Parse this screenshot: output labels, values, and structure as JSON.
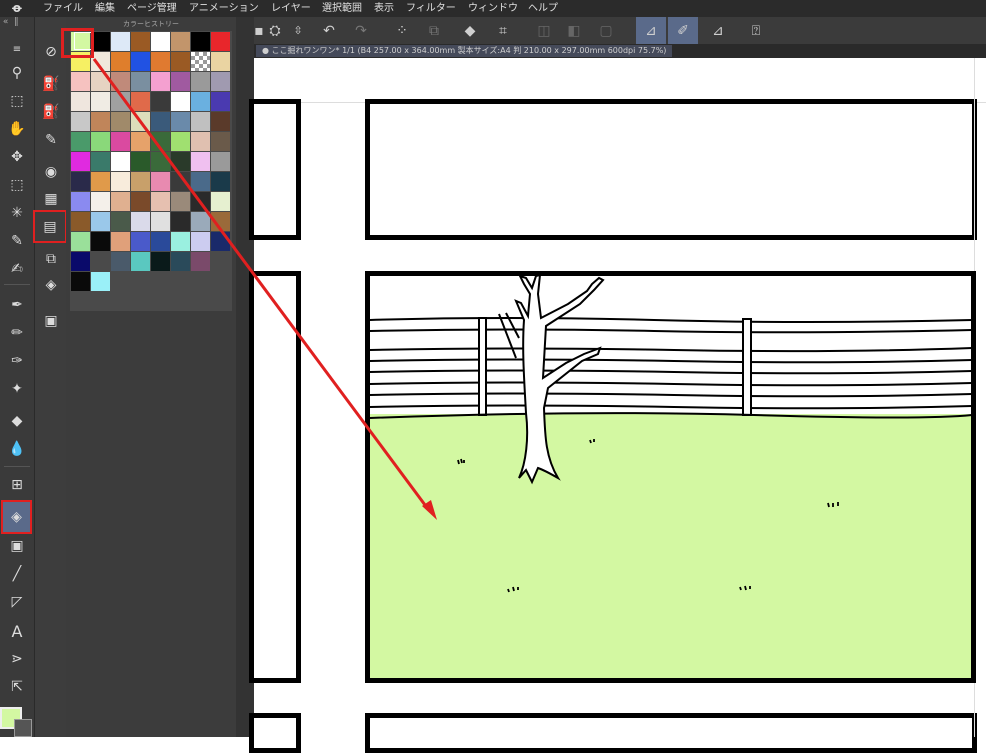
{
  "menubar": {
    "items": [
      "ファイル",
      "編集",
      "ページ管理",
      "アニメーション",
      "レイヤー",
      "選択範囲",
      "表示",
      "フィルター",
      "ウィンドウ",
      "ヘルプ"
    ]
  },
  "palette": {
    "title": "カラーヒストリー",
    "selected_color": "#d3f8a2",
    "swatches": [
      [
        "#d3f8a2",
        "#000000",
        "#dde9f7",
        "#9a5a24",
        "#ffffff",
        "#c2956b",
        "#000000",
        "#e8262b"
      ],
      [
        "#f6f063",
        "#f0e8dc",
        "#df7e2c",
        "#2152e3",
        "#e07a30",
        "#9a5a24",
        "checker",
        "#ead4a2"
      ],
      [
        "#f6c2c0",
        "#e6d3c2",
        "#c08a7a",
        "#7a8fa0",
        "#f4a0d0",
        "#a05aa0",
        "#9a9a9a",
        "#a09ab0"
      ],
      [
        "#efe6de",
        "#f0ece4",
        "#a0a0a0",
        "#e06a4a",
        "#3a3a3a",
        "#ffffff",
        "#6ab0e0",
        "#4a3ab0"
      ],
      [
        "#c8c8c8",
        "#c0855a",
        "#a08a6a",
        "#ddddbb",
        "#3a5a7a",
        "#6a8aaa",
        "#c0c0c0",
        "#5a3a2a"
      ],
      [
        "#4a9a6a",
        "#8ad87a",
        "#da4aa0",
        "#e6a26a",
        "#3a6a3a",
        "#a0e070",
        "#e0c0b0",
        "#6a5a4a"
      ],
      [
        "#e02ae0",
        "#3a7a6a",
        "#ffffff",
        "#2a5a2a",
        "#3a6a3a",
        "#2a3a2a",
        "#f0c0f0",
        "#9a9a9a"
      ],
      [
        "#2a2a4a",
        "#e09a4a",
        "#f8ecdc",
        "#c8a06a",
        "#e88ab0",
        "#3a3a3a",
        "#4a6a8a",
        "#1a3a4a"
      ],
      [
        "#8a8af0",
        "#f4f0ea",
        "#e0b090",
        "#7a4a2a",
        "#e6c0b0",
        "#9a8a7a",
        "#2a2a2a",
        "#e6f0d0"
      ],
      [
        "#8a5a2a",
        "#9ac8ea",
        "#4a5a4a",
        "#dadaea",
        "#e0e0e0",
        "#2a2a2a",
        "#9aaaba",
        "#9a6a3a"
      ],
      [
        "#9ae09a",
        "#0a0a0a",
        "#e0a07a",
        "#4a5aca",
        "#2a4a9a",
        "#9af0e0",
        "#ccccf0",
        "#1a2a6a"
      ],
      [
        "#0a0a6a",
        "#4a4a4a",
        "#4a5a6a",
        "#5ac8c0",
        "#0a1a1a",
        "#2a4a5a",
        "#7a4a6a",
        "#4a4a4a"
      ],
      [
        "#0a0a0a",
        "#9af0f8"
      ]
    ]
  },
  "document": {
    "tab_label": "ここ掘れワンワン* 1/1 (B4 257.00 x 364.00mm 製本サイズ:A4 判 210.00 x 297.00mm 600dpi 75.7%)"
  },
  "tools": {
    "main": [
      "menu-icon",
      "zoom-icon",
      "operation-icon",
      "hand-icon",
      "move-icon",
      "selection-icon",
      "magic-wand-icon",
      "eyedropper-icon",
      "pen-icon",
      "pencil-icon",
      "brush-icon",
      "airbrush-icon",
      "decoration-icon",
      "eraser-icon",
      "blend-icon",
      "frame-icon",
      "fill-icon",
      "gradient-icon",
      "line-icon",
      "ruler-icon",
      "text-icon",
      "balloon-icon",
      "correct-line-icon"
    ],
    "sub": [
      "refer-layer-icon",
      "fill-layer-icon",
      "fill-close-icon",
      "fill-paint-icon",
      "fill-circle-icon",
      "fill-grid-icon",
      "fill-selected-icon",
      "stack-icon",
      "layers-icon",
      "canvas-icon"
    ]
  },
  "colors": {
    "accent_red": "#e02020",
    "grass": "#d3f8a2"
  }
}
